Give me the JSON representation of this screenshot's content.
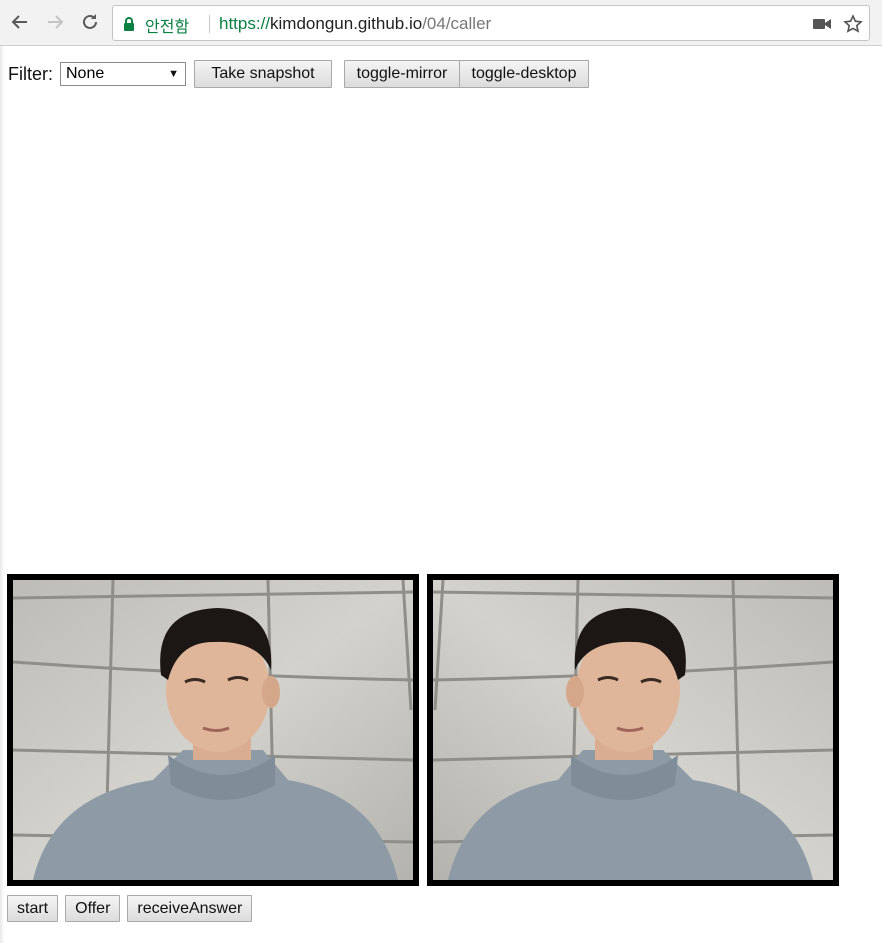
{
  "browser": {
    "secure_label": "안전함",
    "url_scheme": "https://",
    "url_host": "kimdongun.github.io",
    "url_path": "/04/caller",
    "icons": [
      "back-arrow-icon",
      "forward-arrow-icon",
      "reload-icon",
      "lock-icon",
      "camera-icon",
      "star-icon"
    ]
  },
  "toolbar": {
    "filter_label": "Filter:",
    "filter_selected": "None",
    "snapshot_label": "Take snapshot",
    "mirror_label": "toggle-mirror",
    "desktop_label": "toggle-desktop"
  },
  "videos": {
    "local": "camera-feed-person-in-gray-turtleneck",
    "remote": "mirrored-camera-feed-person-in-gray-turtleneck"
  },
  "controls": {
    "start_label": "start",
    "offer_label": "Offer",
    "answer_label": "receiveAnswer"
  },
  "colors": {
    "secure_green": "#0b8043",
    "video_border": "#000000",
    "wall": "#c9c8c2",
    "sweater": "#8c9aa6"
  }
}
